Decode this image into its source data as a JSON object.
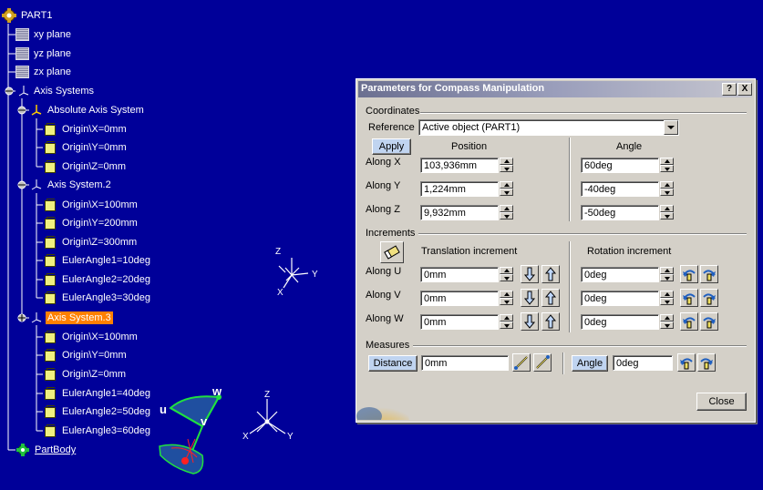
{
  "tree": {
    "items": [
      {
        "label": "PART1",
        "icon": "part-icon"
      },
      {
        "label": "xy plane",
        "icon": "plane-icon"
      },
      {
        "label": "yz plane",
        "icon": "plane-icon"
      },
      {
        "label": "zx plane",
        "icon": "plane-icon"
      },
      {
        "label": "Axis Systems",
        "icon": "axis-systems-icon"
      },
      {
        "label": "Absolute Axis System",
        "icon": "axis-system-icon"
      },
      {
        "label": "Origin\\X=0mm",
        "icon": "parameter-icon"
      },
      {
        "label": "Origin\\Y=0mm",
        "icon": "parameter-icon"
      },
      {
        "label": "Origin\\Z=0mm",
        "icon": "parameter-icon"
      },
      {
        "label": "Axis System.2",
        "icon": "axis-system-icon"
      },
      {
        "label": "Origin\\X=100mm",
        "icon": "parameter-icon"
      },
      {
        "label": "Origin\\Y=200mm",
        "icon": "parameter-icon"
      },
      {
        "label": "Origin\\Z=300mm",
        "icon": "parameter-icon"
      },
      {
        "label": "EulerAngle1=10deg",
        "icon": "parameter-icon"
      },
      {
        "label": "EulerAngle2=20deg",
        "icon": "parameter-icon"
      },
      {
        "label": "EulerAngle3=30deg",
        "icon": "parameter-icon"
      },
      {
        "label": "Axis System.3",
        "icon": "axis-system-icon",
        "selected": true
      },
      {
        "label": "Origin\\X=100mm",
        "icon": "parameter-icon"
      },
      {
        "label": "Origin\\Y=0mm",
        "icon": "parameter-icon"
      },
      {
        "label": "Origin\\Z=0mm",
        "icon": "parameter-icon"
      },
      {
        "label": "EulerAngle1=40deg",
        "icon": "parameter-icon"
      },
      {
        "label": "EulerAngle2=50deg",
        "icon": "parameter-icon"
      },
      {
        "label": "EulerAngle3=60deg",
        "icon": "parameter-icon"
      },
      {
        "label": "PartBody",
        "icon": "part-body-icon",
        "link": true
      }
    ]
  },
  "viewport": {
    "axis1": {
      "x": "X",
      "y": "Y",
      "z": "Z"
    },
    "axis2": {
      "x": "X",
      "y": "Y",
      "z": "Z"
    },
    "compass": {
      "u": "u",
      "v": "v",
      "w": "w"
    }
  },
  "dialog": {
    "title": "Parameters for Compass Manipulation",
    "help_label": "?",
    "close_x_label": "X",
    "coordinates": {
      "group_label": "Coordinates",
      "reference_label": "Reference",
      "reference_value": "Active object (PART1)",
      "apply_label": "Apply",
      "position_header": "Position",
      "angle_header": "Angle",
      "rows": [
        {
          "label": "Along X",
          "position": "103,936mm",
          "angle": "60deg"
        },
        {
          "label": "Along Y",
          "position": "1,224mm",
          "angle": "-40deg"
        },
        {
          "label": "Along Z",
          "position": "9,932mm",
          "angle": "-50deg"
        }
      ]
    },
    "increments": {
      "group_label": "Increments",
      "translation_header": "Translation increment",
      "rotation_header": "Rotation increment",
      "rows": [
        {
          "label": "Along U",
          "translation": "0mm",
          "rotation": "0deg"
        },
        {
          "label": "Along V",
          "translation": "0mm",
          "rotation": "0deg"
        },
        {
          "label": "Along W",
          "translation": "0mm",
          "rotation": "0deg"
        }
      ]
    },
    "measures": {
      "group_label": "Measures",
      "distance_label": "Distance",
      "distance_value": "0mm",
      "angle_label": "Angle",
      "angle_value": "0deg"
    },
    "close_label": "Close"
  },
  "colors": {
    "background": "#000099",
    "selection": "#ff8000",
    "dialog": "#d4d0c8",
    "compass": "#00cc33"
  }
}
